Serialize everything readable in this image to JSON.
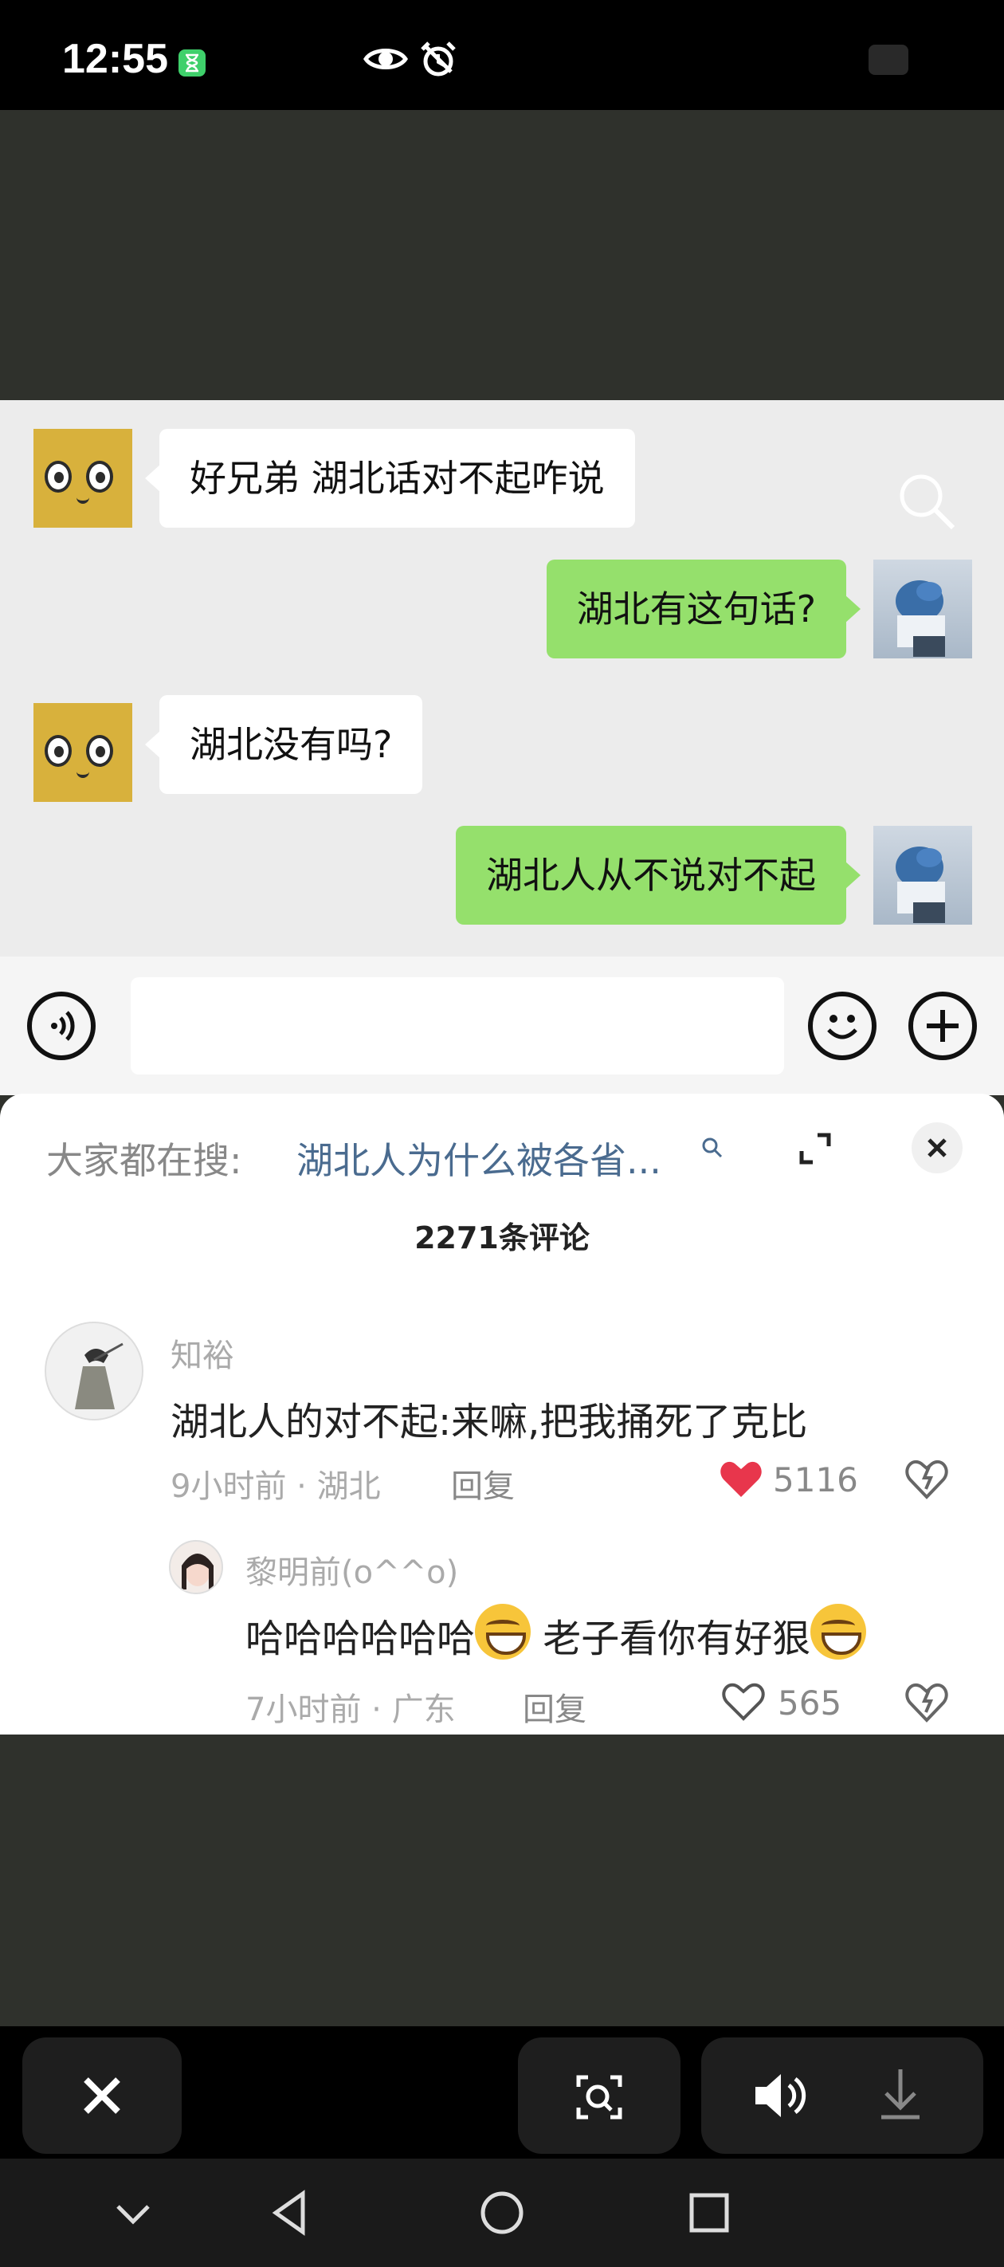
{
  "status_bar": {
    "time": "12:55"
  },
  "chat": {
    "messages": [
      {
        "side": "left",
        "text": "好兄弟 湖北话对不起咋说"
      },
      {
        "side": "right",
        "text": "湖北有这句话?"
      },
      {
        "side": "left",
        "text": "湖北没有吗?"
      },
      {
        "side": "right",
        "text": "湖北人从不说对不起"
      }
    ]
  },
  "comments_sheet": {
    "search_hint_label": "大家都在搜:",
    "search_hint_query": "湖北人为什么被各省...",
    "comment_count": "2271条评论",
    "comments": [
      {
        "author": "知裕",
        "text": "湖北人的对不起:来嘛,把我捅死了克比",
        "meta": "9小时前 · 湖北",
        "reply_label": "回复",
        "likes": "5116",
        "liked": true
      },
      {
        "author": "黎明前(o^^o)",
        "text_part1": "哈哈哈哈哈哈",
        "text_part2": " 老子看你有好狠",
        "meta": "7小时前 · 广东",
        "reply_label": "回复",
        "likes": "565",
        "liked": false
      }
    ]
  },
  "colors": {
    "liked_heart": "#e8364c",
    "green_bubble": "#95e06c",
    "link_blue": "#4a6b8f"
  }
}
